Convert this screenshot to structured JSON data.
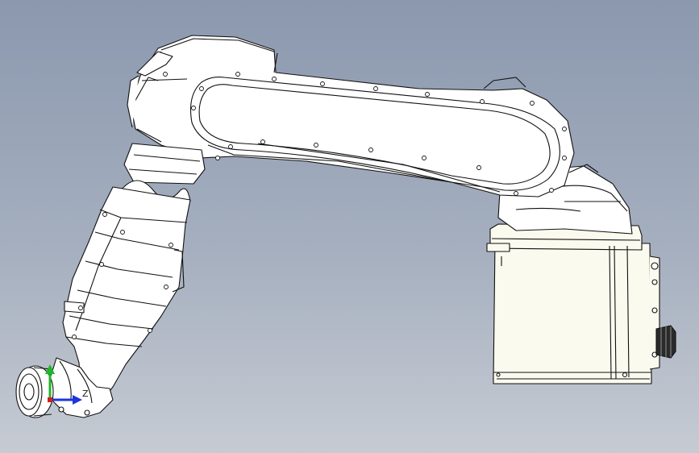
{
  "viewport": {
    "background_top": "#8b98ae",
    "background_bottom": "#c6cbd3"
  },
  "model": {
    "part_fill": "#ffffff",
    "base_fill": "#fbfaee",
    "edge_color": "#111111",
    "connector_fill": "#2a2a2a"
  },
  "triad": {
    "axis_z_label": "Z",
    "x_color": "#d11e1e",
    "y_color": "#1fb62a",
    "z_color": "#1c34e0",
    "icon": "coordinate-triad-icon"
  }
}
